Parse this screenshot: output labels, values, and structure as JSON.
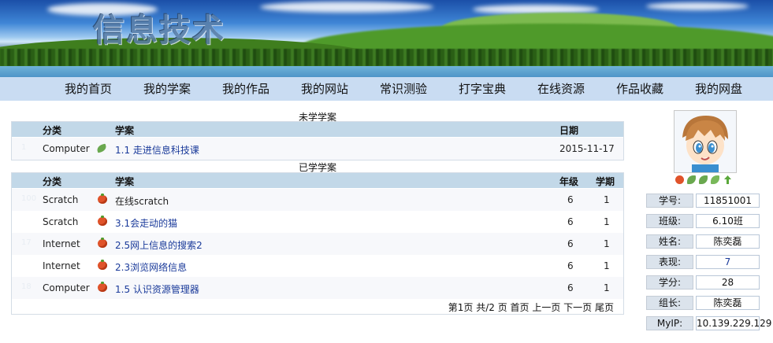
{
  "banner": {
    "title": "信息技术"
  },
  "nav": [
    "我的首页",
    "我的学案",
    "我的作品",
    "我的网站",
    "常识测验",
    "打字宝典",
    "在线资源",
    "作品收藏",
    "我的网盘"
  ],
  "unlearned": {
    "caption": "未学学案",
    "headers": {
      "category": "分类",
      "plan": "学案",
      "date": "日期"
    },
    "rows": [
      {
        "num": "1",
        "category": "Computer",
        "title": "1.1 走进信息科技课",
        "date": "2015-11-17"
      }
    ]
  },
  "learned": {
    "caption": "已学学案",
    "headers": {
      "category": "分类",
      "plan": "学案",
      "grade": "年级",
      "term": "学期"
    },
    "rows": [
      {
        "num": "100",
        "category": "Scratch",
        "title": "在线scratch",
        "grade": "6",
        "term": "1"
      },
      {
        "num": "",
        "category": "Scratch",
        "title": "3.1会走动的猫",
        "grade": "6",
        "term": "1"
      },
      {
        "num": "17",
        "category": "Internet",
        "title": "2.5网上信息的搜索2",
        "grade": "6",
        "term": "1"
      },
      {
        "num": "",
        "category": "Internet",
        "title": "2.3浏览网络信息",
        "grade": "6",
        "term": "1"
      },
      {
        "num": "18",
        "category": "Computer",
        "title": "1.5 认识资源管理器",
        "grade": "6",
        "term": "1"
      }
    ],
    "pager": "第1页 共/2 页 首页 上一页 下一页 尾页"
  },
  "profile": {
    "fields": [
      {
        "label": "学号:",
        "value": "11851001"
      },
      {
        "label": "班级:",
        "value": "6.10班"
      },
      {
        "label": "姓名:",
        "value": "陈奕磊"
      },
      {
        "label": "表现:",
        "value": "7"
      },
      {
        "label": "学分:",
        "value": "28"
      },
      {
        "label": "组长:",
        "value": "陈奕磊"
      },
      {
        "label": "MyIP:",
        "value": "10.139.229.129"
      }
    ]
  },
  "colors": {
    "nav_bg": "#c9dcf2",
    "header_bg": "#c2d8e8",
    "link": "#1a3a9a"
  }
}
